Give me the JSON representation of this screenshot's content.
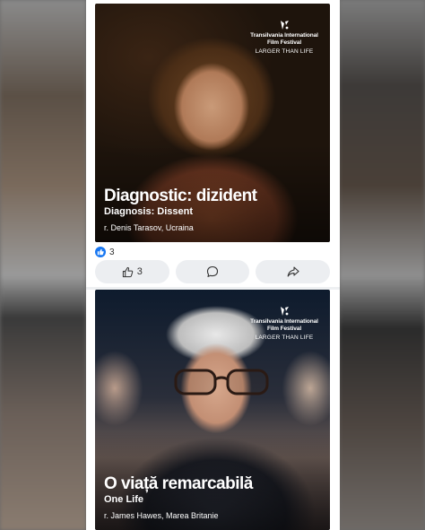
{
  "posts": [
    {
      "festival_name": "Transilvania International Film Festival",
      "festival_tagline": "LARGER THAN LIFE",
      "title_ro": "Diagnostic: dizident",
      "title_en": "Diagnosis: Dissent",
      "credit": "r. Denis Tarasov, Ucraina",
      "reaction_count": "3",
      "actions": {
        "like_count": "3"
      }
    },
    {
      "festival_name": "Transilvania International Film Festival",
      "festival_tagline": "LARGER THAN LIFE",
      "title_ro": "O viață remarcabilă",
      "title_en": "One Life",
      "credit": "r. James Hawes, Marea Britanie"
    }
  ],
  "icons": [
    "like-reaction-icon",
    "thumbs-up-icon",
    "comment-icon",
    "share-icon",
    "festival-logo-icon"
  ],
  "colors": {
    "like_blue": "#1877f2",
    "action_bg": "#eceef1",
    "feed_bg": "#ffffff"
  }
}
